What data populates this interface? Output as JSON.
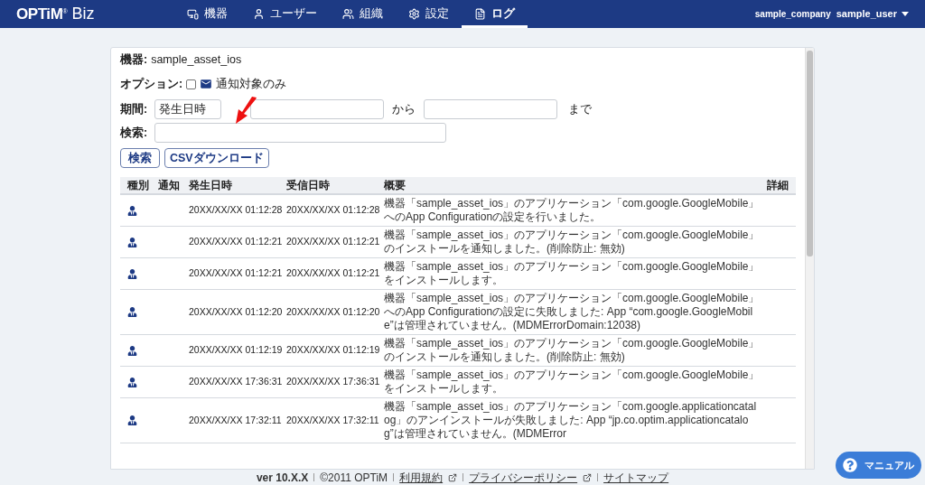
{
  "header": {
    "logo": {
      "brand": "OPTiM",
      "mark": "®",
      "product": "Biz"
    },
    "tabs": [
      {
        "label": "機器",
        "selected": false
      },
      {
        "label": "ユーザー",
        "selected": false
      },
      {
        "label": "組織",
        "selected": false
      },
      {
        "label": "設定",
        "selected": false
      },
      {
        "label": "ログ",
        "selected": true
      }
    ],
    "company": "sample_company",
    "user": "sample_user"
  },
  "filters": {
    "device_label": "機器:",
    "device_value": "sample_asset_ios",
    "option_label": "オプション:",
    "notify_only": {
      "label": "通知対象のみ",
      "checked": false
    },
    "period_label": "期間:",
    "period_type": "発生日時",
    "from_label": "から",
    "to_label": "まで",
    "search_label": "検索:"
  },
  "buttons": [
    "検索",
    "CSVダウンロード"
  ],
  "table": {
    "columns": [
      "種別",
      "通知",
      "発生日時",
      "受信日時",
      "概要",
      "詳細"
    ],
    "rows": [
      {
        "occurred": "20XX/XX/XX 01:12:28",
        "received": "20XX/XX/XX 01:12:28",
        "summary": "機器「sample_asset_ios」のアプリケーション「com.google.GoogleMobile」へのApp Configurationの設定を行いました。"
      },
      {
        "occurred": "20XX/XX/XX 01:12:21",
        "received": "20XX/XX/XX 01:12:21",
        "summary": "機器「sample_asset_ios」のアプリケーション「com.google.GoogleMobile」のインストールを通知しました。(削除防止: 無効)"
      },
      {
        "occurred": "20XX/XX/XX 01:12:21",
        "received": "20XX/XX/XX 01:12:21",
        "summary": "機器「sample_asset_ios」のアプリケーション「com.google.GoogleMobile」をインストールします。"
      },
      {
        "occurred": "20XX/XX/XX 01:12:20",
        "received": "20XX/XX/XX 01:12:20",
        "summary": "機器「sample_asset_ios」のアプリケーション「com.google.GoogleMobile」へのApp Configurationの設定に失敗しました: App “com.google.GoogleMobile”は管理されていません。(MDMErrorDomain:12038)"
      },
      {
        "occurred": "20XX/XX/XX 01:12:19",
        "received": "20XX/XX/XX 01:12:19",
        "summary": "機器「sample_asset_ios」のアプリケーション「com.google.GoogleMobile」のインストールを通知しました。(削除防止: 無効)"
      },
      {
        "occurred": "20XX/XX/XX 17:36:31",
        "received": "20XX/XX/XX 17:36:31",
        "summary": "機器「sample_asset_ios」のアプリケーション「com.google.GoogleMobile」をインストールします。"
      },
      {
        "occurred": "20XX/XX/XX 17:32:11",
        "received": "20XX/XX/XX 17:32:11",
        "summary": "機器「sample_asset_ios」のアプリケーション「com.google.applicationcatalog」のアンインストールが失敗しました: App “jp.co.optim.applicationcatalog”は管理されていません。(MDMError"
      }
    ]
  },
  "footer": {
    "version": "ver 10.X.X",
    "copyright": "©2011 OPTiM",
    "links": [
      {
        "label": "利用規約",
        "external": true
      },
      {
        "label": "プライバシーポリシー",
        "external": true
      },
      {
        "label": "サイトマップ",
        "external": false
      }
    ]
  },
  "manual_button": "マニュアル"
}
